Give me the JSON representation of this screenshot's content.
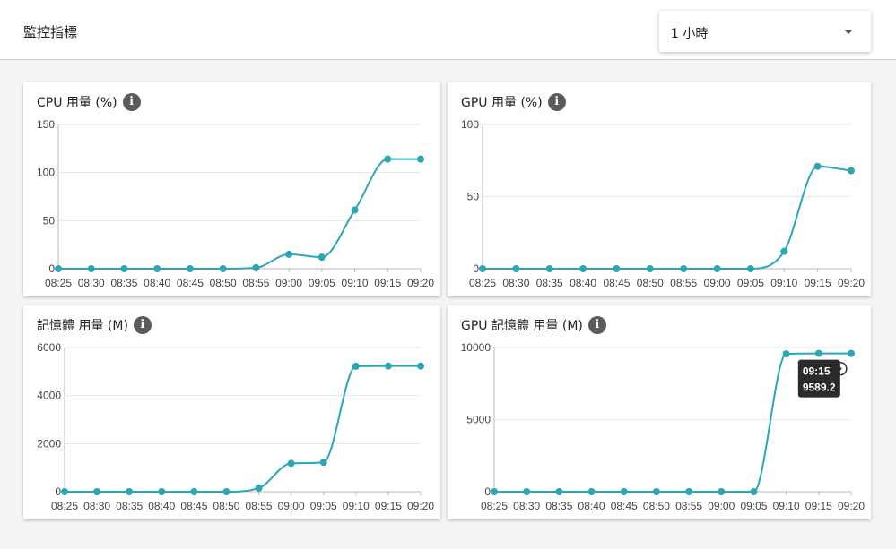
{
  "header": {
    "title": "監控指標",
    "time_range": "1 小時"
  },
  "colors": {
    "series": "#2aa6b5",
    "info_icon": "#5b5b5b"
  },
  "chart_data": [
    {
      "type": "line",
      "title": "CPU 用量 (%)",
      "categories": [
        "08:25",
        "08:30",
        "08:35",
        "08:40",
        "08:45",
        "08:50",
        "08:55",
        "09:00",
        "09:05",
        "09:10",
        "09:15",
        "09:20"
      ],
      "values": [
        0,
        0,
        0,
        0,
        0,
        0,
        1,
        15,
        12,
        61,
        114,
        114
      ],
      "ylim": [
        0,
        150
      ],
      "yticks": [
        "0",
        "50",
        "100",
        "150"
      ],
      "grid": true
    },
    {
      "type": "line",
      "title": "GPU 用量 (%)",
      "categories": [
        "08:25",
        "08:30",
        "08:35",
        "08:40",
        "08:45",
        "08:50",
        "08:55",
        "09:00",
        "09:05",
        "09:10",
        "09:15",
        "09:20"
      ],
      "values": [
        0,
        0,
        0,
        0,
        0,
        0,
        0,
        0,
        0,
        12,
        71,
        68
      ],
      "ylim": [
        0,
        100
      ],
      "yticks": [
        "0",
        "50",
        "100"
      ],
      "grid": true
    },
    {
      "type": "line",
      "title": "記憶體 用量 (M)",
      "categories": [
        "08:25",
        "08:30",
        "08:35",
        "08:40",
        "08:45",
        "08:50",
        "08:55",
        "09:00",
        "09:05",
        "09:10",
        "09:15",
        "09:20"
      ],
      "values": [
        0,
        0,
        0,
        0,
        0,
        0,
        150,
        1180,
        1220,
        5220,
        5230,
        5230
      ],
      "ylim": [
        0,
        6000
      ],
      "yticks": [
        "0",
        "2000",
        "4000",
        "6000"
      ],
      "grid": true
    },
    {
      "type": "line",
      "title": "GPU 記憶體 用量 (M)",
      "categories": [
        "08:25",
        "08:30",
        "08:35",
        "08:40",
        "08:45",
        "08:50",
        "08:55",
        "09:00",
        "09:05",
        "09:10",
        "09:15",
        "09:20"
      ],
      "values": [
        0,
        0,
        0,
        0,
        0,
        0,
        0,
        0,
        0,
        9560,
        9589.2,
        9589.2
      ],
      "ylim": [
        0,
        10000
      ],
      "yticks": [
        "0",
        "5000",
        "10000"
      ],
      "grid": true,
      "tooltip": {
        "time": "09:15",
        "value": "9589.2",
        "index": 10
      }
    }
  ]
}
